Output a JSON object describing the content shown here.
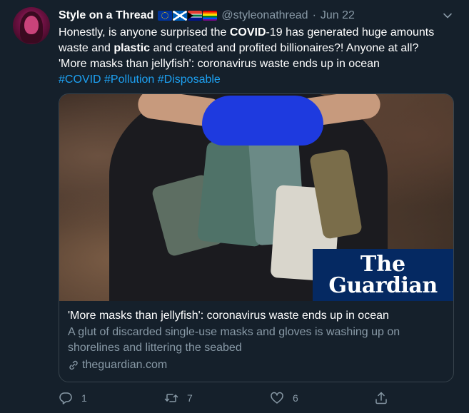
{
  "author": {
    "name": "Style on a Thread",
    "flags": [
      "eu-flag-icon",
      "scotland-flag-icon",
      "south-africa-flag-icon",
      "rainbow-flag-icon"
    ],
    "handle": "@styleonathread",
    "separator": "·",
    "date": "Jun 22"
  },
  "tweet": {
    "line1_pre": "Honestly, is anyone surprised the ",
    "line1_bold": "COVID",
    "line1_post": "-19 has generated huge amounts",
    "line2_pre": "waste and ",
    "line2_bold": "plastic",
    "line2_post": " and created and profited billionaires?!  Anyone at all?",
    "line3": "'More masks than jellyfish': coronavirus waste ends up in ocean",
    "hashtags": [
      "#COVID",
      "#Pollution",
      "#Disposable"
    ]
  },
  "card": {
    "logo_line1": "The",
    "logo_line2": "Guardian",
    "title": "'More masks than jellyfish': coronavirus waste ends up in ocean",
    "description": "A glut of discarded single-use masks and gloves is washing up on shorelines and littering the seabed",
    "domain": "theguardian.com"
  },
  "actions": {
    "reply_count": "1",
    "retweet_count": "7",
    "like_count": "6"
  },
  "colors": {
    "background": "#15202b",
    "secondary_text": "#8899a6",
    "hashtag": "#1da1f2",
    "card_border": "#38444d",
    "guardian_blue": "#052962"
  }
}
